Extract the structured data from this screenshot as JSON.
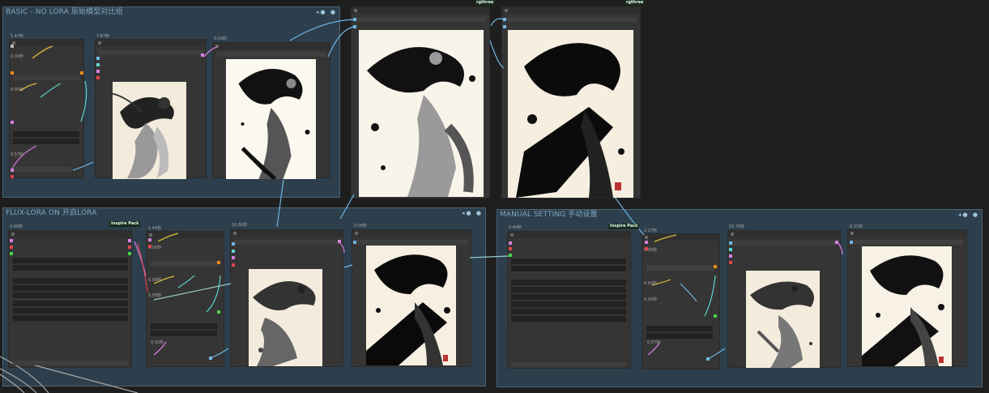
{
  "groups": {
    "basic": {
      "title": "BASIC - NO LORA 原始模型对比组"
    },
    "flux": {
      "title": "FLUX-LORA ON 开启LORA"
    },
    "manual": {
      "title": "MANUAL SETTING 手动设置"
    }
  },
  "badges": {
    "rgthree_1": "rgthree",
    "rgthree_2": "rgthree",
    "inspire_flux": "Inspire Pack",
    "inspire_manual": "Inspire Pack"
  },
  "basic_labels": {
    "t1": "1.47秒",
    "t2": "7.67秒",
    "t3": "0.03秒",
    "t4": "0.00秒",
    "t5": "0.00秒",
    "t6": "0.57秒"
  },
  "flux_labels": {
    "t1": "0.69秒",
    "t2": "1.43秒",
    "t3": "16.60秒",
    "t4": "0.00秒",
    "t5": "0.00秒",
    "t6": "0.00秒",
    "t7": "0.00秒",
    "t8": "0.50秒"
  },
  "manual_labels": {
    "t1": "0.49秒",
    "t2": "2.27秒",
    "t3": "15.70秒",
    "t4": "0.11秒",
    "t5": "0.00秒",
    "t6": "0.00秒",
    "t7": "0.00秒",
    "t8": "0.57秒"
  },
  "icons": {
    "group_controls": "◂● ●",
    "image": "ink-wash-portrait-icon"
  },
  "colors": {
    "group_bg": "#2d3f4c",
    "node_bg": "#353535",
    "wire_blue": "#6fb6e6",
    "wire_cyan": "#5fd6d0",
    "wire_yellow": "#e2c23a",
    "wire_pink": "#d67fe0",
    "paper": "#f3ecdc"
  }
}
